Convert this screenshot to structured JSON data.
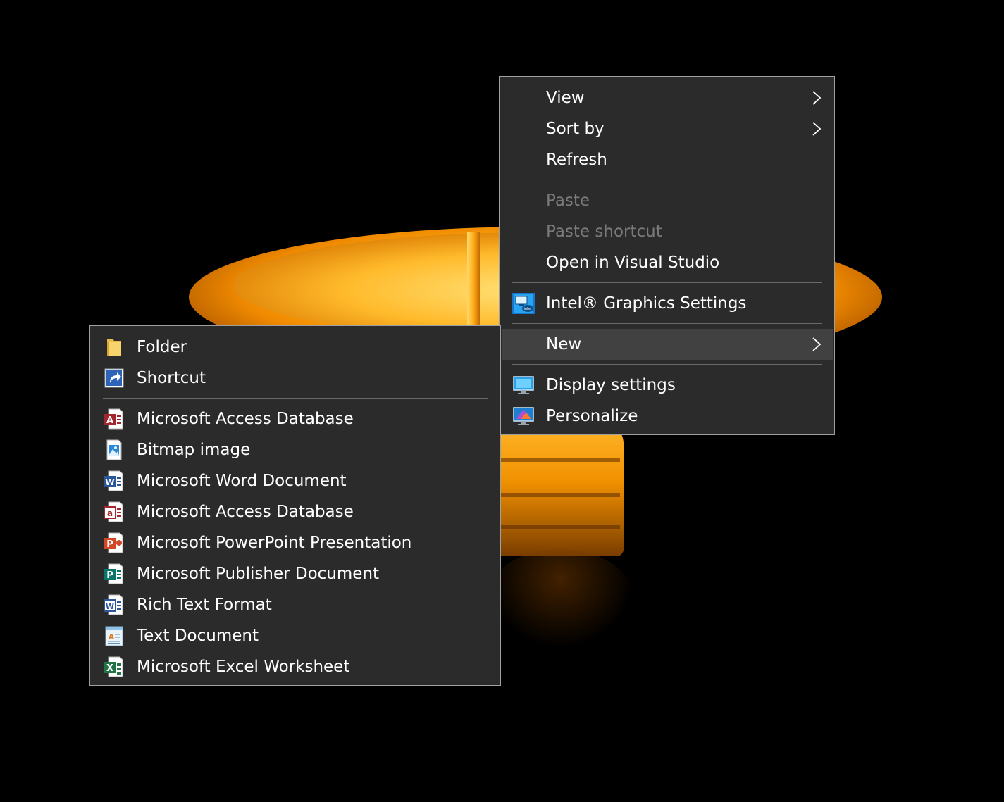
{
  "context_menu": {
    "view_label": "View",
    "sort_by_label": "Sort by",
    "refresh_label": "Refresh",
    "paste_label": "Paste",
    "paste_shortcut_label": "Paste shortcut",
    "open_vs_label": "Open in Visual Studio",
    "intel_graphics_label": "Intel® Graphics Settings",
    "new_label": "New",
    "display_settings_label": "Display settings",
    "personalize_label": "Personalize"
  },
  "new_submenu": {
    "folder_label": "Folder",
    "shortcut_label": "Shortcut",
    "items": [
      {
        "label": "Microsoft Access Database",
        "icon": "access-icon"
      },
      {
        "label": "Bitmap image",
        "icon": "bitmap-icon"
      },
      {
        "label": "Microsoft Word Document",
        "icon": "word-icon"
      },
      {
        "label": "Microsoft Access Database",
        "icon": "access-icon"
      },
      {
        "label": "Microsoft PowerPoint Presentation",
        "icon": "powerpoint-icon"
      },
      {
        "label": "Microsoft Publisher Document",
        "icon": "publisher-icon"
      },
      {
        "label": "Rich Text Format",
        "icon": "rtf-icon"
      },
      {
        "label": "Text Document",
        "icon": "text-document-icon"
      },
      {
        "label": "Microsoft Excel Worksheet",
        "icon": "excel-icon"
      }
    ]
  },
  "colors": {
    "menu_background": "#2b2b2b",
    "menu_border": "#a0a0a0",
    "highlight": "#414141",
    "text": "#ffffff",
    "disabled_text": "#7a7a7a"
  }
}
